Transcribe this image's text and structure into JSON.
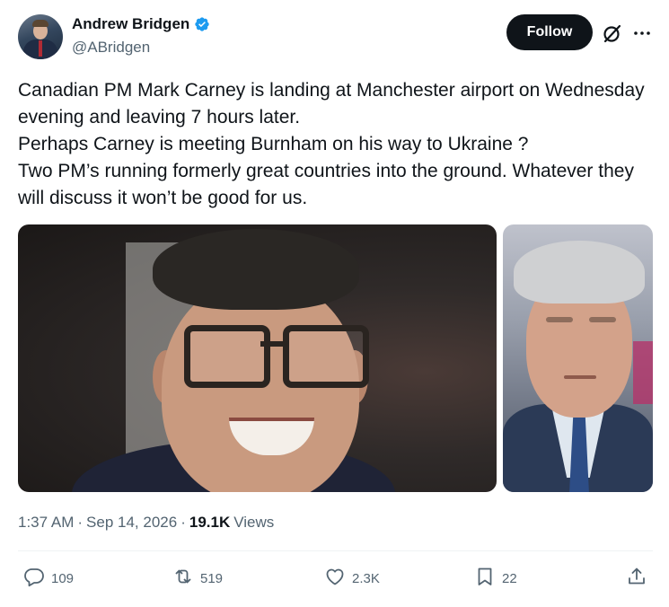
{
  "author": {
    "name": "Andrew Bridgen",
    "handle": "@ABridgen",
    "verified": true
  },
  "header": {
    "follow_label": "Follow",
    "icons": [
      "grok-icon",
      "more-icon"
    ]
  },
  "tweet": {
    "lines": [
      "Canadian PM Mark Carney is landing at Manchester airport on Wednesday evening and leaving 7 hours later.",
      "Perhaps Carney is meeting Burnham on his way to Ukraine ?",
      "Two PM’s running formerly great countries into the ground. Whatever they will discuss it won’t be good for us."
    ]
  },
  "media": [
    {
      "subject": "smiling man with glasses"
    },
    {
      "subject": "grey-haired man in suit"
    }
  ],
  "meta": {
    "time": "1:37 AM",
    "separator": "·",
    "date": "Sep 14, 2026",
    "views_count": "19.1K",
    "views_label": "Views"
  },
  "actions": {
    "replies": "109",
    "reposts": "519",
    "likes": "2.3K",
    "bookmarks": "22"
  },
  "colors": {
    "text": "#0f1419",
    "secondary": "#536471",
    "verified_blue": "#1d9bf0",
    "button_bg": "#0f1419"
  }
}
